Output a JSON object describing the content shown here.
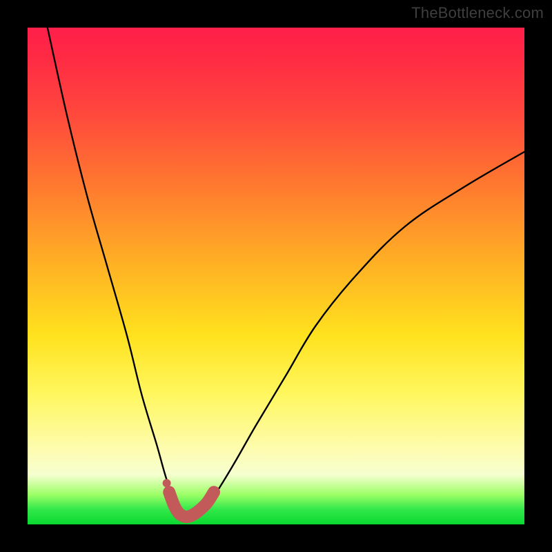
{
  "watermark": "TheBottleneck.com",
  "chart_data": {
    "type": "line",
    "title": "",
    "xlabel": "",
    "ylabel": "",
    "xlim": [
      0,
      100
    ],
    "ylim": [
      0,
      100
    ],
    "grid": false,
    "series": [
      {
        "name": "bottleneck-curve",
        "color": "#000000",
        "x": [
          4,
          8,
          12,
          16,
          20,
          23,
          26,
          28,
          30,
          31,
          32,
          33,
          35,
          37,
          39,
          42,
          46,
          52,
          58,
          66,
          76,
          88,
          100
        ],
        "values": [
          100,
          82,
          66,
          52,
          38,
          26,
          16,
          9,
          4,
          2,
          1.5,
          2,
          3,
          5,
          8,
          13,
          20,
          30,
          40,
          50,
          60,
          68,
          75
        ]
      },
      {
        "name": "highlight-segment",
        "color": "#c35a5a",
        "x": [
          28.5,
          29.5,
          30.5,
          31.5,
          32.5,
          34,
          36,
          37.5
        ],
        "values": [
          6.5,
          3.8,
          2.2,
          1.6,
          1.6,
          2.4,
          4.2,
          6.5
        ]
      }
    ],
    "markers": [
      {
        "name": "highlight-dot",
        "x": 28,
        "y": 8.3,
        "color": "#c35a5a",
        "r": 6
      }
    ],
    "gradient_stops": [
      {
        "pos": 0,
        "color": "#ff1f4a"
      },
      {
        "pos": 50,
        "color": "#ffd21e"
      },
      {
        "pos": 88,
        "color": "#fbfca8"
      },
      {
        "pos": 100,
        "color": "#0ad830"
      }
    ]
  }
}
